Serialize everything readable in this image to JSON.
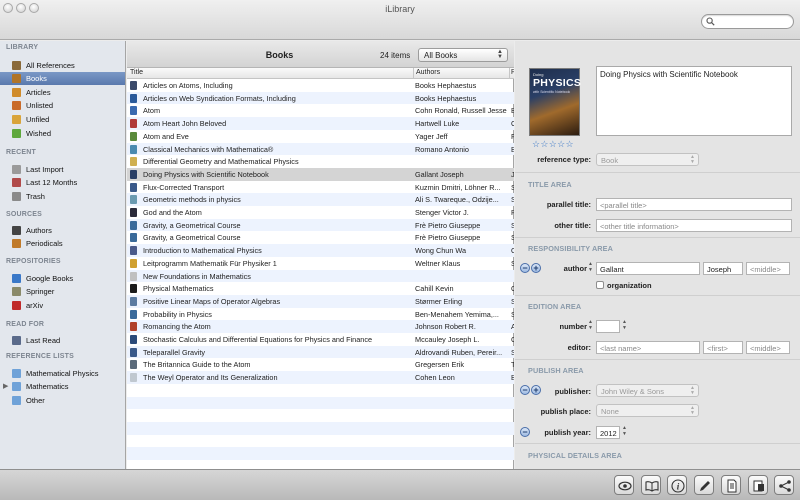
{
  "window": {
    "title": "iLibrary"
  },
  "search": {
    "placeholder": "",
    "value": ""
  },
  "sidebar": {
    "sections": [
      {
        "heading": "LIBRARY",
        "items": [
          {
            "label": "All References",
            "icon": "books-stack-icon",
            "color": "#8a6a3a"
          },
          {
            "label": "Books",
            "icon": "book-icon",
            "color": "#b07428",
            "selected": true
          },
          {
            "label": "Articles",
            "icon": "article-icon",
            "color": "#d08b2a"
          },
          {
            "label": "Unlisted",
            "icon": "unlisted-icon",
            "color": "#c96b2a"
          },
          {
            "label": "Unfiled",
            "icon": "unfiled-icon",
            "color": "#d9a43a"
          },
          {
            "label": "Wished",
            "icon": "wished-checkmark-icon",
            "color": "#5ea83c"
          }
        ]
      },
      {
        "heading": "RECENT",
        "items": [
          {
            "label": "Last Import",
            "icon": "clock-icon",
            "color": "#9a9a9a"
          },
          {
            "label": "Last 12 Months",
            "icon": "calendar-icon",
            "color": "#b04a4a"
          },
          {
            "label": "Trash",
            "icon": "trash-icon",
            "color": "#8a8a8a"
          }
        ]
      },
      {
        "heading": "SOURCES",
        "items": [
          {
            "label": "Authors",
            "icon": "people-icon",
            "color": "#444444"
          },
          {
            "label": "Periodicals",
            "icon": "periodicals-icon",
            "color": "#c07a2a"
          }
        ]
      },
      {
        "heading": "REPOSITORIES",
        "items": [
          {
            "label": "Google Books",
            "icon": "google-books-icon",
            "color": "#3a78c8"
          },
          {
            "label": "Springer",
            "icon": "springer-icon",
            "color": "#8a8a6a"
          },
          {
            "label": "arXiv",
            "icon": "arxiv-icon",
            "color": "#c02a2a"
          }
        ]
      },
      {
        "heading": "READ FOR",
        "items": [
          {
            "label": "Last Read",
            "icon": "glasses-icon",
            "color": "#5a6a8a"
          }
        ]
      },
      {
        "heading": "REFERENCE LISTS",
        "items": [
          {
            "label": "Mathematical Physics",
            "icon": "folder-icon",
            "color": "#6fa2d8"
          },
          {
            "label": "Mathematics",
            "icon": "folder-icon",
            "color": "#6fa2d8",
            "disclosure": "▶"
          },
          {
            "label": "Other",
            "icon": "folder-icon",
            "color": "#6fa2d8"
          }
        ]
      }
    ]
  },
  "list": {
    "title": "Books",
    "count": "24 items",
    "filter": "All Books",
    "columns": {
      "title": "Title",
      "authors": "Authors",
      "extra": "P"
    },
    "rows": [
      {
        "title": "Articles on Atoms, Including",
        "authors": "Books Hephaestus",
        "x": "",
        "ic": "#3a4a6a"
      },
      {
        "title": "Articles on Web Syndication Formats, Including",
        "authors": "Books Hephaestus",
        "x": "",
        "ic": "#2a5a9a"
      },
      {
        "title": "Atom",
        "authors": "Cohn Ronald, Russell Jesse",
        "x": "B",
        "ic": "#3a6ab0"
      },
      {
        "title": "Atom Heart John Beloved",
        "authors": "Hartwell Luke",
        "x": "C",
        "ic": "#b03a3a"
      },
      {
        "title": "Atom and Eve",
        "authors": "Yager Jeff",
        "x": "F",
        "ic": "#5a8a3a"
      },
      {
        "title": "Classical Mechanics with Mathematica®",
        "authors": "Romano Antonio",
        "x": "B",
        "ic": "#4a8ab0"
      },
      {
        "title": "Differential Geometry and Mathematical Physics",
        "authors": "",
        "x": "",
        "ic": "#d0b050"
      },
      {
        "title": "Doing Physics with Scientific Notebook",
        "authors": "Gallant Joseph",
        "x": "J",
        "ic": "#2a3f66"
      },
      {
        "title": "Flux-Corrected Transport",
        "authors": "Kuzmin Dmitri, Löhner R...",
        "x": "S",
        "ic": "#3a5a8a"
      },
      {
        "title": "Geometric methods in physics",
        "authors": "Ali S. Twareque., Odzije...",
        "x": "S",
        "ic": "#6a9ab0"
      },
      {
        "title": "God and the Atom",
        "authors": "Stenger Victor J.",
        "x": "P",
        "ic": "#2a2a3a"
      },
      {
        "title": "Gravity, a Geometrical Course",
        "authors": "Frè Pietro Giuseppe",
        "x": "S",
        "ic": "#3a6a9a"
      },
      {
        "title": "Gravity, a Geometrical Course",
        "authors": "Frè Pietro Giuseppe",
        "x": "S",
        "ic": "#3a6a9a"
      },
      {
        "title": "Introduction to Mathematical Physics",
        "authors": "Wong Chun Wa",
        "x": "O",
        "ic": "#4a5a8a"
      },
      {
        "title": "Leitprogramm Mathematik Für Physiker 1",
        "authors": "Weltner Klaus",
        "x": "S",
        "ic": "#d0a030"
      },
      {
        "title": "New Foundations in Mathematics",
        "authors": "",
        "x": "",
        "ic": "#c0c0c0"
      },
      {
        "title": "Physical Mathematics",
        "authors": "Cahill Kevin",
        "x": "C",
        "ic": "#1a1a1a"
      },
      {
        "title": "Positive Linear Maps of Operator Algebras",
        "authors": "Størmer Erling",
        "x": "S",
        "ic": "#5a7aa0"
      },
      {
        "title": "Probability in Physics",
        "authors": "Ben-Menahem Yemima,...",
        "x": "S",
        "ic": "#3a6a9a"
      },
      {
        "title": "Romancing the Atom",
        "authors": "Johnson Robert R.",
        "x": "A",
        "ic": "#b0402a"
      },
      {
        "title": "Stochastic Calculus and Differential Equations for Physics and Finance",
        "authors": "Mccauley Joseph L.",
        "x": "C",
        "ic": "#2a4a7a"
      },
      {
        "title": "Teleparallel Gravity",
        "authors": "Aldrovandi Ruben, Pereir...",
        "x": "S",
        "ic": "#3a5a8a"
      },
      {
        "title": "The Britannica Guide to the Atom",
        "authors": "Gregersen Erik",
        "x": "T",
        "ic": "#5a6a7a"
      },
      {
        "title": "The Weyl Operator and Its Generalization",
        "authors": "Cohen Leon",
        "x": "B",
        "ic": "#c0c8d0"
      }
    ],
    "selected_index": 7
  },
  "details": {
    "cover": {
      "line1": "Doing",
      "line2": "PHYSICS",
      "line3": "with Scientific Notebook"
    },
    "rating": "☆☆☆☆☆",
    "title_value": "Doing Physics with Scientific Notebook",
    "reference_type": {
      "label": "reference type:",
      "value": "Book"
    },
    "title_area": {
      "heading": "TITLE AREA",
      "parallel_label": "parallel title:",
      "parallel_placeholder": "<parallel title>",
      "other_label": "other title:",
      "other_placeholder": "<other title information>"
    },
    "responsibility_area": {
      "heading": "RESPONSIBILITY AREA",
      "author_label": "author",
      "last": "Gallant",
      "first": "Joseph",
      "middle_placeholder": "<middle>",
      "organization_label": "organization"
    },
    "edition_area": {
      "heading": "EDITION AREA",
      "number_label": "number",
      "editor_label": "editor:",
      "last_placeholder": "<last name>",
      "first_placeholder": "<first>",
      "middle_placeholder": "<middle>"
    },
    "publish_area": {
      "heading": "PUBLISH AREA",
      "publisher_label": "publisher:",
      "publisher_value": "John Wiley & Sons",
      "place_label": "publish place:",
      "place_value": "None",
      "year_label": "publish year:",
      "year_value": "2012"
    },
    "physical_area": {
      "heading": "PHYSICAL DETAILS AREA"
    }
  },
  "toolbar": {
    "buttons": [
      "eye-icon",
      "open-book-icon",
      "info-icon",
      "edit-pencil-icon",
      "document-icon",
      "export-icon",
      "share-icon"
    ]
  }
}
